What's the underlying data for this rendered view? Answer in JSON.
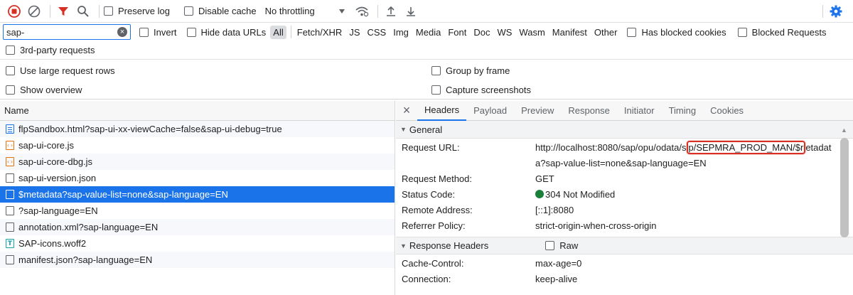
{
  "toolbar": {
    "preserve_log": "Preserve log",
    "disable_cache": "Disable cache",
    "throttling": "No throttling"
  },
  "filter": {
    "search_value": "sap-",
    "invert": "Invert",
    "hide_data_urls": "Hide data URLs",
    "types": [
      "All",
      "Fetch/XHR",
      "JS",
      "CSS",
      "Img",
      "Media",
      "Font",
      "Doc",
      "WS",
      "Wasm",
      "Manifest",
      "Other"
    ],
    "has_blocked_cookies": "Has blocked cookies",
    "blocked_requests": "Blocked Requests",
    "third_party": "3rd-party requests"
  },
  "settings": {
    "large_rows": "Use large request rows",
    "group_by_frame": "Group by frame",
    "show_overview": "Show overview",
    "capture_screenshots": "Capture screenshots"
  },
  "requests": {
    "header": "Name",
    "items": [
      {
        "name": "flpSandbox.html?sap-ui-xx-viewCache=false&sap-ui-debug=true",
        "icon": "doc"
      },
      {
        "name": "sap-ui-core.js",
        "icon": "js"
      },
      {
        "name": "sap-ui-core-dbg.js",
        "icon": "js"
      },
      {
        "name": "sap-ui-version.json",
        "icon": "file"
      },
      {
        "name": "$metadata?sap-value-list=none&sap-language=EN",
        "icon": "file"
      },
      {
        "name": "?sap-language=EN",
        "icon": "file"
      },
      {
        "name": "annotation.xml?sap-language=EN",
        "icon": "file"
      },
      {
        "name": "SAP-icons.woff2",
        "icon": "font"
      },
      {
        "name": "manifest.json?sap-language=EN",
        "icon": "file"
      }
    ]
  },
  "details": {
    "tabs": [
      "Headers",
      "Payload",
      "Preview",
      "Response",
      "Initiator",
      "Timing",
      "Cookies"
    ],
    "general_title": "General",
    "url_key": "Request URL:",
    "url_pre": "http://localhost:8080/sap/opu/odata/s",
    "url_hl": "p/SEPMRA_PROD_MAN/$r",
    "url_post": "etadata?sap-value-list=none&sap-language=EN",
    "method_key": "Request Method:",
    "method_val": "GET",
    "status_key": "Status Code:",
    "status_val": "304 Not Modified",
    "remote_key": "Remote Address:",
    "remote_val": "[::1]:8080",
    "referrer_key": "Referrer Policy:",
    "referrer_val": "strict-origin-when-cross-origin",
    "response_headers_title": "Response Headers",
    "raw_label": "Raw",
    "cache_key": "Cache-Control:",
    "cache_val": "max-age=0",
    "connection_key": "Connection:",
    "connection_val": "keep-alive"
  },
  "colors": {
    "accent": "#1a73e8",
    "record": "#d93025",
    "filter": "#d93025",
    "status_ok": "#188038"
  }
}
